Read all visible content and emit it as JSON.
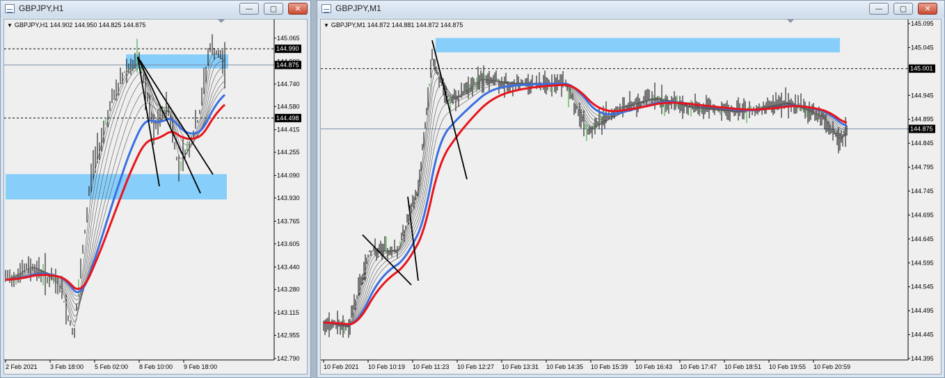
{
  "windows": [
    {
      "id": "h1",
      "title": "GBPJPY,H1",
      "header": "GBPJPY,H1  144.902 144.950 144.825 144.875",
      "price_labels": [
        "145.065",
        "144.900",
        "144.740",
        "144.580",
        "144.415",
        "144.255",
        "144.090",
        "143.930",
        "143.765",
        "143.605",
        "143.440",
        "143.280",
        "143.115",
        "142.955",
        "142.790"
      ],
      "time_labels": [
        "2 Feb 2021",
        "3 Feb 18:00",
        "5 Feb 02:00",
        "8 Feb 10:00",
        "9 Feb 18:00"
      ],
      "level_tags": [
        "144.990",
        "144.875",
        "144.498"
      ],
      "buttons": {
        "minimize": "—",
        "maximize": "▢",
        "close": "✕"
      }
    },
    {
      "id": "m1",
      "title": "GBPJPY,M1",
      "header": "GBPJPY,M1  144.872 144.881 144.872 144.875",
      "price_labels": [
        "145.095",
        "145.045",
        "145.001",
        "144.945",
        "144.895",
        "144.875",
        "144.845",
        "144.795",
        "144.745",
        "144.695",
        "144.645",
        "144.595",
        "144.545",
        "144.495",
        "144.445",
        "144.395"
      ],
      "time_labels": [
        "10 Feb 2021",
        "10 Feb 10:19",
        "10 Feb 11:23",
        "10 Feb 12:27",
        "10 Feb 13:31",
        "10 Feb 14:35",
        "10 Feb 15:39",
        "10 Feb 16:43",
        "10 Feb 17:47",
        "10 Feb 18:51",
        "10 Feb 19:55",
        "10 Feb 20:59"
      ],
      "level_tags": [
        "145.001",
        "144.875"
      ],
      "buttons": {
        "minimize": "—",
        "maximize": "▢",
        "close": "✕"
      }
    }
  ],
  "colors": {
    "ema_red": "#e8141a",
    "ema_blue": "#3a6fe0",
    "zone": "#87cefa",
    "price_bar": "#000000",
    "tag_bg": "#000000"
  }
}
